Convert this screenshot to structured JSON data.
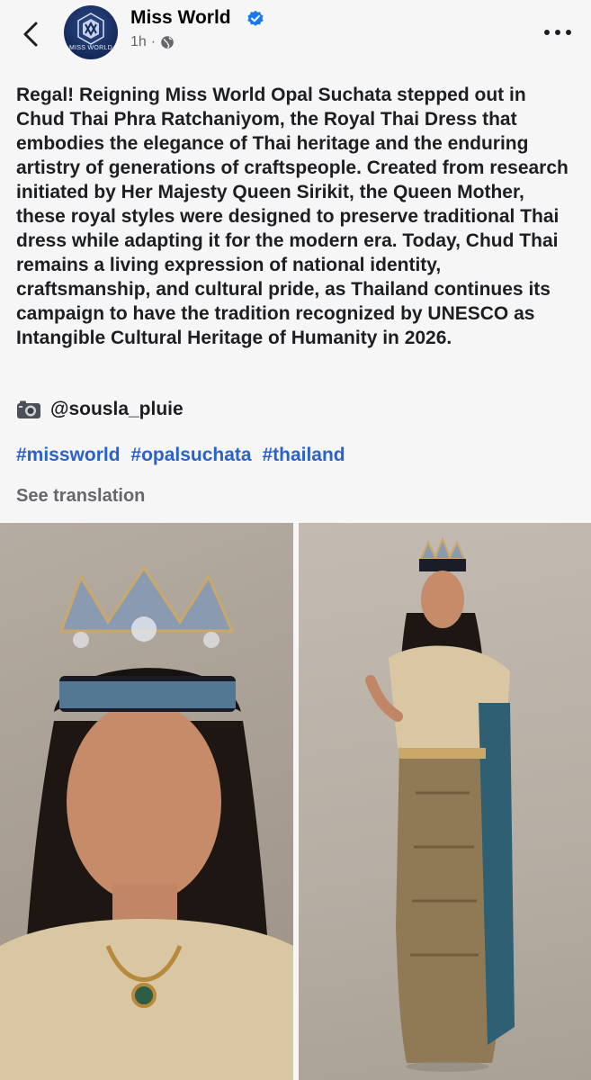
{
  "post": {
    "page_name": "Miss World",
    "avatar_text": "MISS WORLD",
    "time": "1h",
    "separator": "·",
    "text": "Regal! Reigning Miss World Opal Suchata stepped out in Chud Thai Phra Ratchaniyom, the Royal Thai Dress that embodies the elegance of Thai heritage and the enduring artistry of generations of craftspeople. Created from research initiated by Her Majesty Queen Sirikit, the Queen Mother, these royal styles were designed to preserve traditional Thai dress while adapting it for the modern era. Today, Chud Thai remains a living expression of national identity, craftsmanship, and cultural pride, as Thailand continues its campaign to have the tradition recognized by UNESCO as Intangible Cultural Heritage of Humanity in 2026.",
    "credit": "@sousla_pluie",
    "hashtags": [
      "#missworld",
      "#opalsuchata",
      "#thailand"
    ],
    "see_translation": "See translation"
  },
  "icons": {
    "back": "chevron-left-icon",
    "verified": "verified-badge-icon",
    "audience": "globe-icon",
    "more": "more-horizontal-icon",
    "camera": "camera-icon"
  },
  "colors": {
    "background": "#f6f6f6",
    "hashtag": "#2a62c9",
    "verified": "#1877f2",
    "muted": "#65676b",
    "avatar": "#142a5c"
  }
}
